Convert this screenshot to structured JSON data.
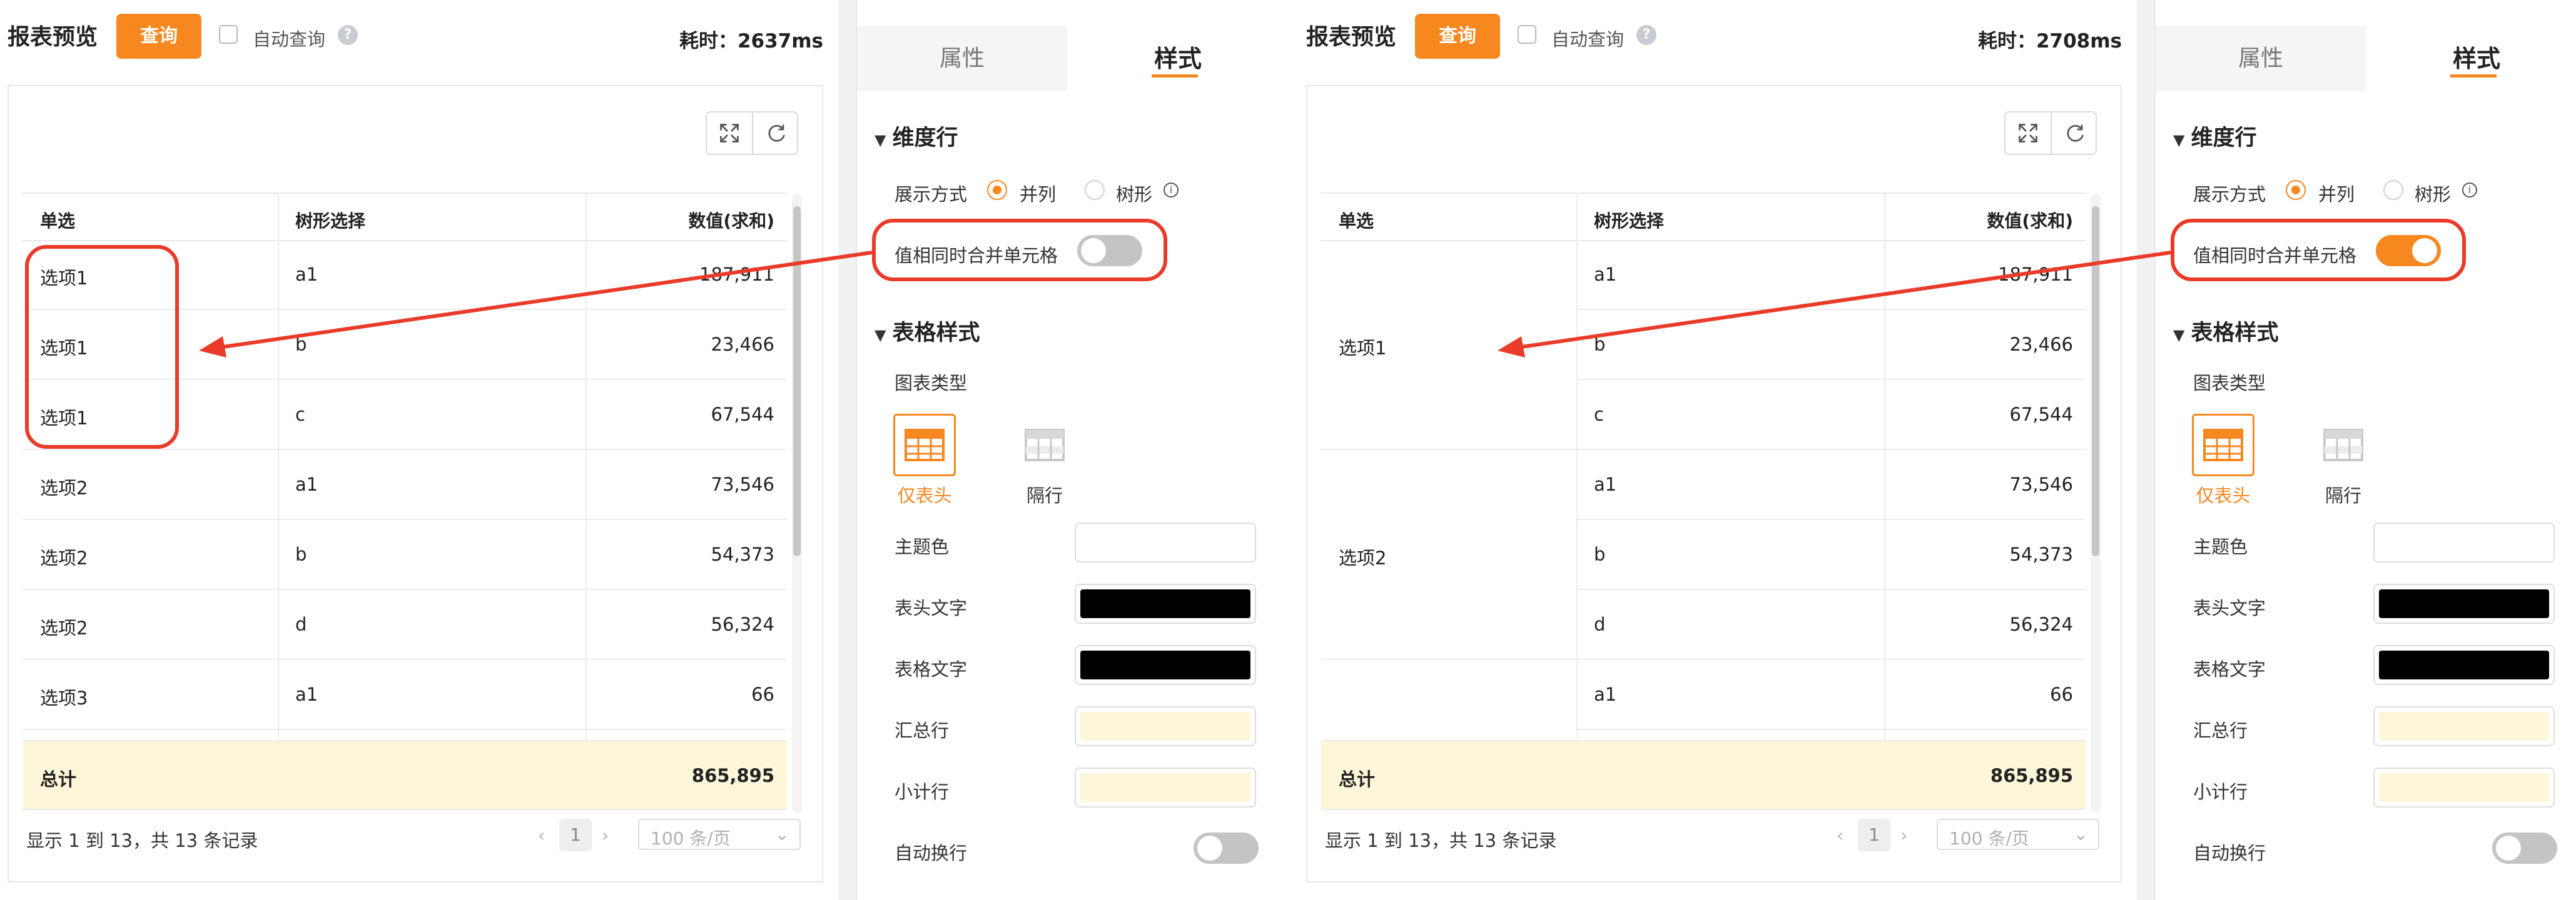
{
  "left": {
    "header": {
      "title": "报表预览",
      "query_button": "查询",
      "auto_query_label": "自动查询",
      "help_glyph": "?",
      "timing": "耗时：2637ms"
    },
    "table": {
      "columns": [
        "单选",
        "树形选择",
        "数值(求和)"
      ],
      "rows": [
        {
          "c1": "选项1",
          "c2": "a1",
          "c3": "187,911"
        },
        {
          "c1": "选项1",
          "c2": "b",
          "c3": "23,466"
        },
        {
          "c1": "选项1",
          "c2": "c",
          "c3": "67,544"
        },
        {
          "c1": "选项2",
          "c2": "a1",
          "c3": "73,546"
        },
        {
          "c1": "选项2",
          "c2": "b",
          "c3": "54,373"
        },
        {
          "c1": "选项2",
          "c2": "d",
          "c3": "56,324"
        },
        {
          "c1": "选项3",
          "c2": "a1",
          "c3": "66"
        }
      ],
      "total": {
        "label": "总计",
        "value": "865,895"
      }
    },
    "pager": {
      "summary": "显示 1 到 13，共 13 条记录",
      "prev": "‹",
      "page": "1",
      "next": "›",
      "page_size": "100 条/页",
      "dropdown": "⌄"
    },
    "settings": {
      "tab_props": "属性",
      "tab_style": "样式",
      "dimension_row": "维度行",
      "display_mode_label": "展示方式",
      "mode_parallel": "并列",
      "mode_tree": "树形",
      "info_glyph": "i",
      "merge_label": "值相同时合并单元格",
      "merge_on": false,
      "table_style": "表格样式",
      "chart_type_label": "图表类型",
      "type_header_only": "仅表头",
      "type_stripe": "隔行",
      "theme_color_label": "主题色",
      "header_text_label": "表头文字",
      "table_text_label": "表格文字",
      "summary_row_label": "汇总行",
      "subtotal_row_label": "小计行",
      "auto_wrap_label": "自动换行",
      "colors": {
        "theme": "#ffffff",
        "header_text": "#000000",
        "table_text": "#000000",
        "summary_row": "#fdf6d8",
        "subtotal_row": "#fdf6d8"
      }
    }
  },
  "right": {
    "header": {
      "title": "报表预览",
      "query_button": "查询",
      "auto_query_label": "自动查询",
      "help_glyph": "?",
      "timing": "耗时：2708ms"
    },
    "table": {
      "columns": [
        "单选",
        "树形选择",
        "数值(求和)"
      ],
      "groups": [
        {
          "label": "选项1",
          "rows": [
            {
              "c2": "a1",
              "c3": "187,911"
            },
            {
              "c2": "b",
              "c3": "23,466"
            },
            {
              "c2": "c",
              "c3": "67,544"
            }
          ]
        },
        {
          "label": "选项2",
          "rows": [
            {
              "c2": "a1",
              "c3": "73,546"
            },
            {
              "c2": "b",
              "c3": "54,373"
            },
            {
              "c2": "d",
              "c3": "56,324"
            }
          ]
        },
        {
          "label": "",
          "rows": [
            {
              "c2": "a1",
              "c3": "66"
            }
          ]
        }
      ],
      "total": {
        "label": "总计",
        "value": "865,895"
      }
    },
    "pager": {
      "summary": "显示 1 到 13，共 13 条记录",
      "prev": "‹",
      "page": "1",
      "next": "›",
      "page_size": "100 条/页",
      "dropdown": "⌄"
    },
    "settings": {
      "tab_props": "属性",
      "tab_style": "样式",
      "dimension_row": "维度行",
      "display_mode_label": "展示方式",
      "mode_parallel": "并列",
      "mode_tree": "树形",
      "info_glyph": "i",
      "merge_label": "值相同时合并单元格",
      "merge_on": true,
      "table_style": "表格样式",
      "chart_type_label": "图表类型",
      "type_header_only": "仅表头",
      "type_stripe": "隔行",
      "theme_color_label": "主题色",
      "header_text_label": "表头文字",
      "table_text_label": "表格文字",
      "summary_row_label": "汇总行",
      "subtotal_row_label": "小计行",
      "auto_wrap_label": "自动换行",
      "colors": {
        "theme": "#ffffff",
        "header_text": "#000000",
        "table_text": "#000000",
        "summary_row": "#fdf6d8",
        "subtotal_row": "#fdf6d8"
      }
    }
  },
  "accent_color": "#f7871f",
  "annotation_color": "#ea3b2a"
}
